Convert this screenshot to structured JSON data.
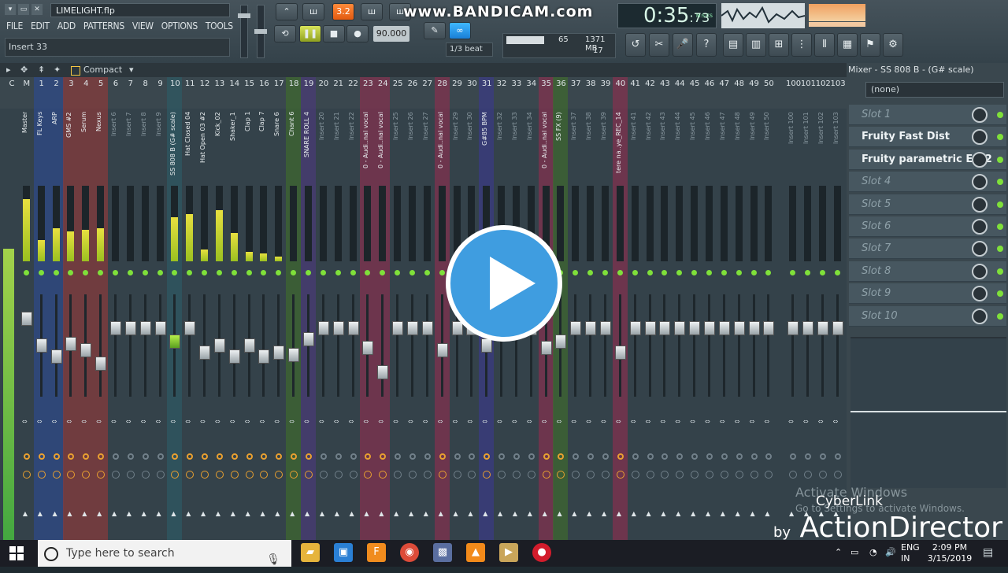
{
  "topbar": {
    "filename": "LIMELIGHT.flp",
    "menu": [
      "FILE",
      "EDIT",
      "ADD",
      "PATTERNS",
      "VIEW",
      "OPTIONS",
      "TOOLS",
      "?"
    ],
    "hint": "Insert 33",
    "tempo": "90.000",
    "watermark": "www.BANDICAM.com",
    "time": "0:35",
    "time_frac": ":73",
    "time_label": "M:S:CS",
    "cpu": "65",
    "mem": "1371 MB",
    "voices": "17",
    "snap": "1/3 beat"
  },
  "mixer": {
    "view": "Compact",
    "channels": [
      {
        "num": "C",
        "name": "",
        "level": 0,
        "fader": 0,
        "hl": "none"
      },
      {
        "num": "M",
        "name": "Master",
        "level": 82,
        "fader": 0,
        "hl": "none"
      },
      {
        "num": "1",
        "name": "FL Keys",
        "level": 28,
        "fader": 46,
        "hl": "blue"
      },
      {
        "num": "2",
        "name": "ARP",
        "level": 44,
        "fader": 56,
        "hl": "blue"
      },
      {
        "num": "3",
        "name": "GMS #2",
        "level": 40,
        "fader": 44,
        "hl": "red"
      },
      {
        "num": "4",
        "name": "Serum",
        "level": 42,
        "fader": 50,
        "hl": "red"
      },
      {
        "num": "5",
        "name": "Nexus",
        "level": 44,
        "fader": 62,
        "hl": "red"
      },
      {
        "num": "6",
        "name": "Insert 6",
        "level": 0,
        "fader": 30,
        "hl": "none"
      },
      {
        "num": "7",
        "name": "Insert 7",
        "level": 0,
        "fader": 30,
        "hl": "none"
      },
      {
        "num": "8",
        "name": "Insert 8",
        "level": 0,
        "fader": 30,
        "hl": "none"
      },
      {
        "num": "9",
        "name": "Insert 9",
        "level": 0,
        "fader": 30,
        "hl": "none"
      },
      {
        "num": "10",
        "name": "SS 808 B (G# scale)",
        "level": 58,
        "fader": 42,
        "hl": "teal"
      },
      {
        "num": "11",
        "name": "Hat Closed 04",
        "level": 62,
        "fader": 30,
        "hl": "none"
      },
      {
        "num": "12",
        "name": "Hat Open 03 #2",
        "level": 16,
        "fader": 52,
        "hl": "none"
      },
      {
        "num": "13",
        "name": "Kick_02",
        "level": 68,
        "fader": 46,
        "hl": "none"
      },
      {
        "num": "14",
        "name": "Shaker_1",
        "level": 38,
        "fader": 56,
        "hl": "none"
      },
      {
        "num": "15",
        "name": "Clap 1",
        "level": 12,
        "fader": 46,
        "hl": "none"
      },
      {
        "num": "16",
        "name": "Clap 7",
        "level": 10,
        "fader": 56,
        "hl": "none"
      },
      {
        "num": "17",
        "name": "Snare 6",
        "level": 6,
        "fader": 52,
        "hl": "none"
      },
      {
        "num": "18",
        "name": "Chant 6",
        "level": 0,
        "fader": 54,
        "hl": "green"
      },
      {
        "num": "19",
        "name": "SNARE ROLL 4",
        "level": 0,
        "fader": 40,
        "hl": "purple"
      },
      {
        "num": "20",
        "name": "Insert 20",
        "level": 0,
        "fader": 30,
        "hl": "none"
      },
      {
        "num": "21",
        "name": "Insert 21",
        "level": 0,
        "fader": 30,
        "hl": "none"
      },
      {
        "num": "22",
        "name": "Insert 22",
        "level": 0,
        "fader": 30,
        "hl": "none"
      },
      {
        "num": "23",
        "name": "0 - Audi..nal vocal",
        "level": 0,
        "fader": 48,
        "hl": "pink"
      },
      {
        "num": "24",
        "name": "0 - Audi..nal vocal",
        "level": 0,
        "fader": 70,
        "hl": "pink"
      },
      {
        "num": "25",
        "name": "Insert 25",
        "level": 0,
        "fader": 30,
        "hl": "none"
      },
      {
        "num": "26",
        "name": "Insert 26",
        "level": 0,
        "fader": 30,
        "hl": "none"
      },
      {
        "num": "27",
        "name": "Insert 27",
        "level": 0,
        "fader": 30,
        "hl": "none"
      },
      {
        "num": "28",
        "name": "0 - Audi..nal vocal",
        "level": 0,
        "fader": 50,
        "hl": "pink"
      },
      {
        "num": "29",
        "name": "Insert 29",
        "level": 0,
        "fader": 30,
        "hl": "none"
      },
      {
        "num": "30",
        "name": "Insert 30",
        "level": 0,
        "fader": 30,
        "hl": "none"
      },
      {
        "num": "31",
        "name": "G#85 BPM",
        "level": 0,
        "fader": 46,
        "hl": "indigo"
      },
      {
        "num": "32",
        "name": "Insert 32",
        "level": 0,
        "fader": 30,
        "hl": "none"
      },
      {
        "num": "33",
        "name": "Insert 33",
        "level": 0,
        "fader": 30,
        "hl": "none"
      },
      {
        "num": "34",
        "name": "Insert 34",
        "level": 0,
        "fader": 30,
        "hl": "none"
      },
      {
        "num": "35",
        "name": "0 - Audi..nal vocal",
        "level": 0,
        "fader": 48,
        "hl": "pink"
      },
      {
        "num": "36",
        "name": "SS FX (9)",
        "level": 0,
        "fader": 42,
        "hl": "green"
      },
      {
        "num": "37",
        "name": "Insert 37",
        "level": 0,
        "fader": 30,
        "hl": "none"
      },
      {
        "num": "38",
        "name": "Insert 38",
        "level": 0,
        "fader": 30,
        "hl": "none"
      },
      {
        "num": "39",
        "name": "Insert 39",
        "level": 0,
        "fader": 30,
        "hl": "none"
      },
      {
        "num": "40",
        "name": "tere na..ye_REC_14",
        "level": 0,
        "fader": 52,
        "hl": "pink"
      },
      {
        "num": "41",
        "name": "Insert 41",
        "level": 0,
        "fader": 30,
        "hl": "none"
      },
      {
        "num": "42",
        "name": "Insert 42",
        "level": 0,
        "fader": 30,
        "hl": "none"
      },
      {
        "num": "43",
        "name": "Insert 43",
        "level": 0,
        "fader": 30,
        "hl": "none"
      },
      {
        "num": "44",
        "name": "Insert 44",
        "level": 0,
        "fader": 30,
        "hl": "none"
      },
      {
        "num": "45",
        "name": "Insert 45",
        "level": 0,
        "fader": 30,
        "hl": "none"
      },
      {
        "num": "46",
        "name": "Insert 46",
        "level": 0,
        "fader": 30,
        "hl": "none"
      },
      {
        "num": "47",
        "name": "Insert 47",
        "level": 0,
        "fader": 30,
        "hl": "none"
      },
      {
        "num": "48",
        "name": "Insert 48",
        "level": 0,
        "fader": 30,
        "hl": "none"
      },
      {
        "num": "49",
        "name": "Insert 49",
        "level": 0,
        "fader": 30,
        "hl": "none"
      },
      {
        "num": "50",
        "name": "Insert 50",
        "level": 0,
        "fader": 30,
        "hl": "none"
      },
      {
        "num": "100",
        "name": "Insert 100",
        "level": 0,
        "fader": 30,
        "hl": "none"
      },
      {
        "num": "101",
        "name": "Insert 101",
        "level": 0,
        "fader": 30,
        "hl": "none"
      },
      {
        "num": "102",
        "name": "Insert 102",
        "level": 0,
        "fader": 30,
        "hl": "none"
      },
      {
        "num": "103",
        "name": "Insert 103",
        "level": 0,
        "fader": 30,
        "hl": "none"
      }
    ]
  },
  "panel": {
    "title": "Mixer - SS 808 B - (G# scale)",
    "select": "(none)",
    "slots": [
      {
        "label": "Slot 1",
        "on": false
      },
      {
        "label": "Fruity Fast Dist",
        "on": true
      },
      {
        "label": "Fruity parametric EQ 2",
        "on": true
      },
      {
        "label": "Slot 4",
        "on": false
      },
      {
        "label": "Slot 5",
        "on": false
      },
      {
        "label": "Slot 6",
        "on": false
      },
      {
        "label": "Slot 7",
        "on": false
      },
      {
        "label": "Slot 8",
        "on": false
      },
      {
        "label": "Slot 9",
        "on": false
      },
      {
        "label": "Slot 10",
        "on": false
      }
    ]
  },
  "overlay": {
    "activate": "Activate Windows",
    "activate_sub": "Go to Settings to activate Windows.",
    "brand_top": "CyberLink",
    "brand_by": "by",
    "brand_main": "ActionDirector"
  },
  "taskbar": {
    "search": "Type here to search",
    "lang1": "ENG",
    "lang2": "IN",
    "time": "2:09 PM",
    "date": "3/15/2019"
  },
  "colors": {
    "red": "#8a3a3a",
    "blue": "#2e4a8a",
    "teal": "#2d5a64",
    "green": "#3e6a2e",
    "purple": "#4a3a78",
    "pink": "#86314e",
    "indigo": "#3a3a86"
  }
}
